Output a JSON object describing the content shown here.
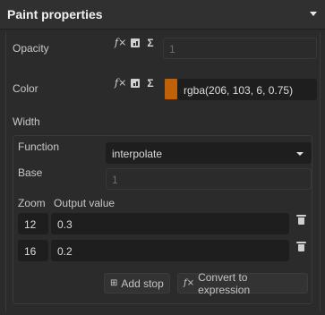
{
  "header": {
    "title": "Paint properties"
  },
  "opacity": {
    "label": "Opacity",
    "placeholder": "1"
  },
  "color": {
    "label": "Color",
    "value": "rgba(206, 103, 6, 0.75)",
    "swatch_color": "#ce6706"
  },
  "width": {
    "label": "Width",
    "function_label": "Function",
    "function_value": "interpolate",
    "base_label": "Base",
    "base_placeholder": "1",
    "columns": {
      "zoom": "Zoom",
      "output": "Output value"
    },
    "stops": [
      {
        "zoom": "12",
        "output": "0.3"
      },
      {
        "zoom": "16",
        "output": "0.2"
      }
    ],
    "add_stop_label": "Add stop",
    "convert_label": "Convert to expression"
  },
  "icons": {
    "function": "fx-icon",
    "data": "data-driven-icon",
    "sigma": "sigma-icon",
    "delete": "trash-icon",
    "add": "add-stop-icon"
  }
}
